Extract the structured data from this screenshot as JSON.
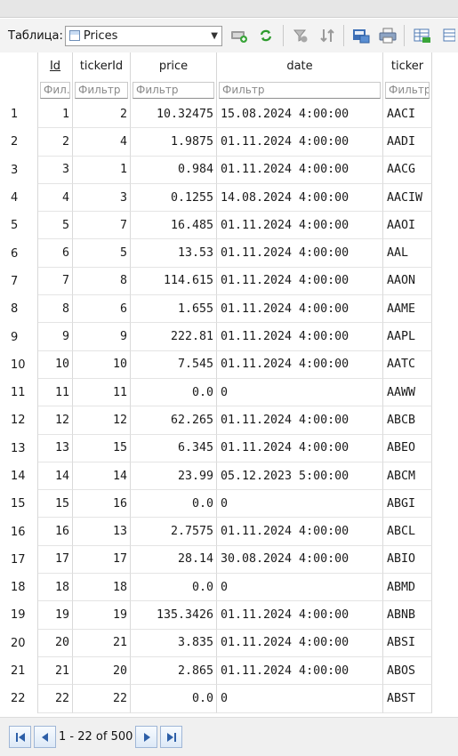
{
  "toolbar": {
    "table_label": "Таблица:",
    "selected_table": "Prices"
  },
  "columns": [
    {
      "label": "Id",
      "filter": "Фил…"
    },
    {
      "label": "tickerId",
      "filter": "Фильтр"
    },
    {
      "label": "price",
      "filter": "Фильтр"
    },
    {
      "label": "date",
      "filter": "Фильтр"
    },
    {
      "label": "ticker",
      "filter": "Фильтр"
    }
  ],
  "rows": [
    {
      "n": "1",
      "id": "1",
      "tickerId": "2",
      "price": "10.32475",
      "date": "15.08.2024 4:00:00",
      "ticker": "AACI"
    },
    {
      "n": "2",
      "id": "2",
      "tickerId": "4",
      "price": "1.9875",
      "date": "01.11.2024 4:00:00",
      "ticker": "AADI"
    },
    {
      "n": "3",
      "id": "3",
      "tickerId": "1",
      "price": "0.984",
      "date": "01.11.2024 4:00:00",
      "ticker": "AACG"
    },
    {
      "n": "4",
      "id": "4",
      "tickerId": "3",
      "price": "0.1255",
      "date": "14.08.2024 4:00:00",
      "ticker": "AACIW"
    },
    {
      "n": "5",
      "id": "5",
      "tickerId": "7",
      "price": "16.485",
      "date": "01.11.2024 4:00:00",
      "ticker": "AAOI"
    },
    {
      "n": "6",
      "id": "6",
      "tickerId": "5",
      "price": "13.53",
      "date": "01.11.2024 4:00:00",
      "ticker": "AAL"
    },
    {
      "n": "7",
      "id": "7",
      "tickerId": "8",
      "price": "114.615",
      "date": "01.11.2024 4:00:00",
      "ticker": "AAON"
    },
    {
      "n": "8",
      "id": "8",
      "tickerId": "6",
      "price": "1.655",
      "date": "01.11.2024 4:00:00",
      "ticker": "AAME"
    },
    {
      "n": "9",
      "id": "9",
      "tickerId": "9",
      "price": "222.81",
      "date": "01.11.2024 4:00:00",
      "ticker": "AAPL"
    },
    {
      "n": "10",
      "id": "10",
      "tickerId": "10",
      "price": "7.545",
      "date": "01.11.2024 4:00:00",
      "ticker": "AATC"
    },
    {
      "n": "11",
      "id": "11",
      "tickerId": "11",
      "price": "0.0",
      "date": "0",
      "ticker": "AAWW"
    },
    {
      "n": "12",
      "id": "12",
      "tickerId": "12",
      "price": "62.265",
      "date": "01.11.2024 4:00:00",
      "ticker": "ABCB"
    },
    {
      "n": "13",
      "id": "13",
      "tickerId": "15",
      "price": "6.345",
      "date": "01.11.2024 4:00:00",
      "ticker": "ABEO"
    },
    {
      "n": "14",
      "id": "14",
      "tickerId": "14",
      "price": "23.99",
      "date": "05.12.2023 5:00:00",
      "ticker": "ABCM"
    },
    {
      "n": "15",
      "id": "15",
      "tickerId": "16",
      "price": "0.0",
      "date": "0",
      "ticker": "ABGI"
    },
    {
      "n": "16",
      "id": "16",
      "tickerId": "13",
      "price": "2.7575",
      "date": "01.11.2024 4:00:00",
      "ticker": "ABCL"
    },
    {
      "n": "17",
      "id": "17",
      "tickerId": "17",
      "price": "28.14",
      "date": "30.08.2024 4:00:00",
      "ticker": "ABIO"
    },
    {
      "n": "18",
      "id": "18",
      "tickerId": "18",
      "price": "0.0",
      "date": "0",
      "ticker": "ABMD"
    },
    {
      "n": "19",
      "id": "19",
      "tickerId": "19",
      "price": "135.3426",
      "date": "01.11.2024 4:00:00",
      "ticker": "ABNB"
    },
    {
      "n": "20",
      "id": "20",
      "tickerId": "21",
      "price": "3.835",
      "date": "01.11.2024 4:00:00",
      "ticker": "ABSI"
    },
    {
      "n": "21",
      "id": "21",
      "tickerId": "20",
      "price": "2.865",
      "date": "01.11.2024 4:00:00",
      "ticker": "ABOS"
    },
    {
      "n": "22",
      "id": "22",
      "tickerId": "22",
      "price": "0.0",
      "date": "0",
      "ticker": "ABST"
    }
  ],
  "pager": {
    "text": "1 - 22 of 500"
  },
  "icons": {
    "toolbar": [
      "new-record-icon",
      "refresh-icon",
      "clear-filters-icon",
      "sort-icon",
      "save-table-icon",
      "print-icon",
      "insert-record-icon",
      "delete-record-icon"
    ],
    "pager": [
      "first-page-icon",
      "previous-page-icon",
      "next-page-icon",
      "last-page-icon"
    ]
  }
}
